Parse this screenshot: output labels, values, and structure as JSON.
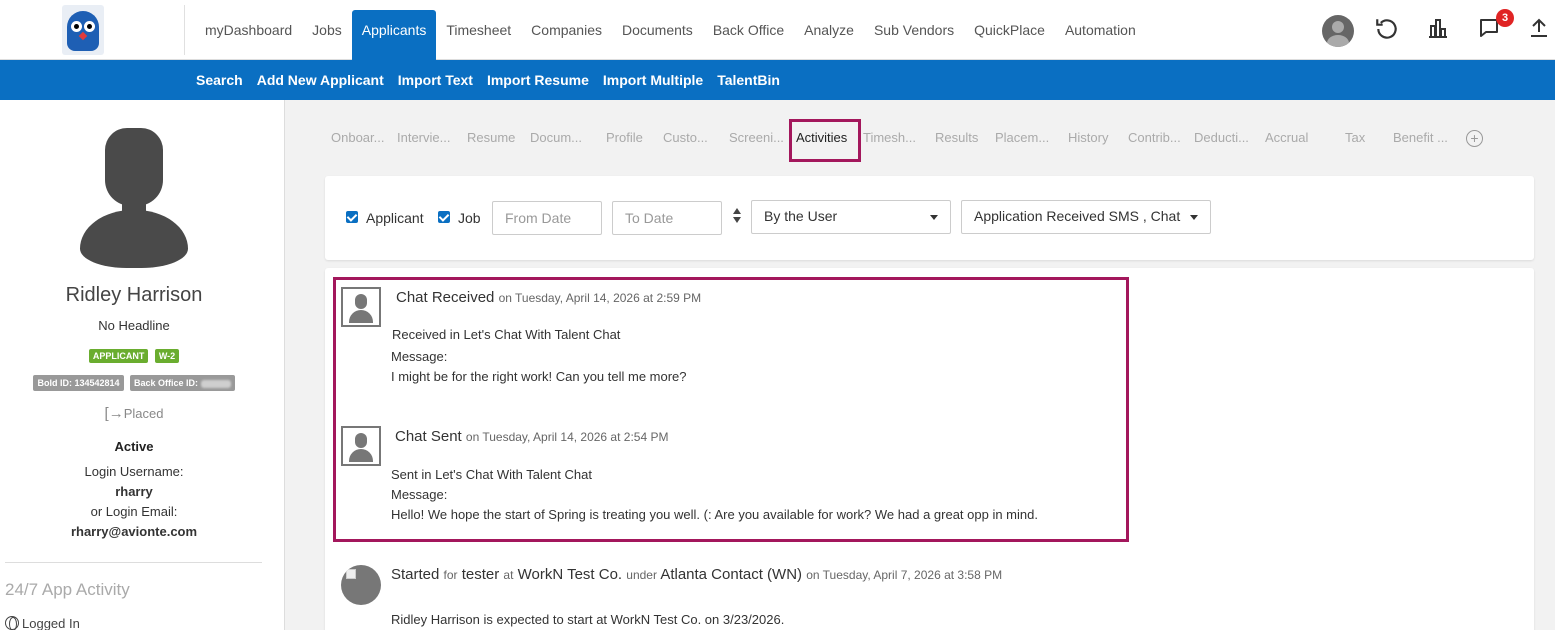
{
  "topnav": {
    "items": [
      "myDashboard",
      "Jobs",
      "Applicants",
      "Timesheet",
      "Companies",
      "Documents",
      "Back Office",
      "Analyze",
      "Sub Vendors",
      "QuickPlace",
      "Automation"
    ],
    "active_index": 2,
    "notification_count": "3"
  },
  "subnav": {
    "items": [
      "Search",
      "Add New Applicant",
      "Import Text",
      "Import Resume",
      "Import Multiple",
      "TalentBin"
    ]
  },
  "profile": {
    "name": "Ridley Harrison",
    "headline": "No Headline",
    "tag_applicant": "APPLICANT",
    "tag_w2": "W-2",
    "bold_id": "Bold ID: 134542814",
    "back_office_id_label": "Back Office ID:",
    "placed": "Placed",
    "status": "Active",
    "login_username_label": "Login Username:",
    "login_username": "rharry",
    "login_email_label": "or Login Email:",
    "login_email": "rharry@avionte.com",
    "app_activity_title": "24/7 App Activity",
    "logged_in": "Logged In"
  },
  "tabs": [
    "Onboar...",
    "Intervie...",
    "Resume",
    "Docum...",
    "Profile",
    "Custo...",
    "Screeni...",
    "Activities",
    "Timesh...",
    "Results",
    "Placem...",
    "History",
    "Contrib...",
    "Deducti...",
    "Accrual",
    "Tax",
    "Benefit ..."
  ],
  "active_tab": "Activities",
  "filters": {
    "applicant_label": "Applicant",
    "job_label": "Job",
    "from_date_placeholder": "From Date",
    "to_date_placeholder": "To Date",
    "user_select": "By the User",
    "type_select": "Application Received SMS , Chat"
  },
  "activities": [
    {
      "title": "Chat Received",
      "date": "on Tuesday, April 14, 2026 at 2:59 PM",
      "line1": "Received  in Let's Chat With Talent Chat",
      "line2": "Message:",
      "line3": "I might be for the right work! Can you tell me more?"
    },
    {
      "title": "Chat Sent",
      "date": "on Tuesday, April 14, 2026 at 2:54 PM",
      "line1": "Sent in Let's Chat With Talent Chat",
      "line2": "Message:",
      "line3": "Hello! We hope the start of Spring is treating you well. (: Are you available for work? We had a great opp in mind."
    },
    {
      "title": "Started",
      "for_label": "for",
      "person": "tester",
      "at_label": "at",
      "company": "WorkN Test Co.",
      "under_label": "under",
      "contact": "Atlanta Contact (WN)",
      "date": "on Tuesday, April 7, 2026 at 3:58 PM",
      "line1": "Ridley Harrison is expected to start at WorkN Test Co. on 3/23/2026."
    }
  ],
  "colors": {
    "brand_blue": "#0a6fc2",
    "highlight": "#a3175c",
    "tag_green": "#6aad2f",
    "badge_red": "#e02424"
  }
}
